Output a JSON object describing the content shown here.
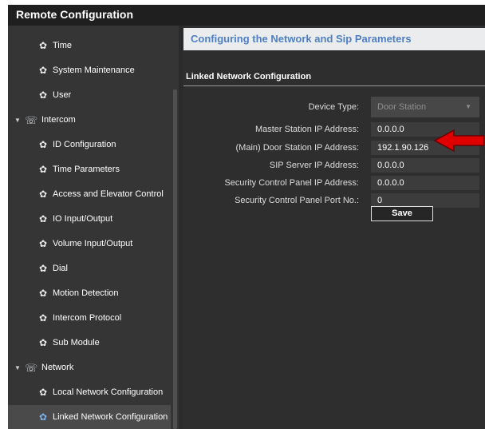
{
  "window": {
    "title": "Remote Configuration"
  },
  "sidebar": {
    "items": [
      {
        "label": "Time",
        "level": 2,
        "icon": "gear-icon"
      },
      {
        "label": "System Maintenance",
        "level": 2,
        "icon": "gear-icon"
      },
      {
        "label": "User",
        "level": 2,
        "icon": "gear-icon"
      },
      {
        "label": "Intercom",
        "level": 1,
        "icon": "intercom-icon",
        "expanded": true
      },
      {
        "label": "ID Configuration",
        "level": 2,
        "icon": "gear-icon"
      },
      {
        "label": "Time Parameters",
        "level": 2,
        "icon": "gear-icon"
      },
      {
        "label": "Access and Elevator Control",
        "level": 2,
        "icon": "gear-icon"
      },
      {
        "label": "IO Input/Output",
        "level": 2,
        "icon": "gear-icon"
      },
      {
        "label": "Volume Input/Output",
        "level": 2,
        "icon": "gear-icon"
      },
      {
        "label": "Dial",
        "level": 2,
        "icon": "gear-icon"
      },
      {
        "label": "Motion Detection",
        "level": 2,
        "icon": "gear-icon"
      },
      {
        "label": "Intercom Protocol",
        "level": 2,
        "icon": "gear-icon"
      },
      {
        "label": "Sub Module",
        "level": 2,
        "icon": "gear-icon"
      },
      {
        "label": "Network",
        "level": 1,
        "icon": "network-icon",
        "expanded": true
      },
      {
        "label": "Local Network Configuration",
        "level": 2,
        "icon": "gear-icon"
      },
      {
        "label": "Linked Network Configuration",
        "level": 2,
        "icon": "gear-icon",
        "selected": true
      }
    ]
  },
  "main": {
    "header": "Configuring the Network and Sip Parameters",
    "section_title": "Linked Network Configuration",
    "form": {
      "device_type": {
        "label": "Device Type:",
        "value": "Door Station"
      },
      "master_station_ip": {
        "label": "Master Station IP Address:",
        "value": "0.0.0.0"
      },
      "door_station_ip": {
        "label": "(Main) Door Station IP Address:",
        "value": "192.1.90.126"
      },
      "sip_server_ip": {
        "label": "SIP Server IP Address:",
        "value": "0.0.0.0"
      },
      "security_panel_ip": {
        "label": "Security Control Panel IP Address:",
        "value": "0.0.0.0"
      },
      "security_panel_port": {
        "label": "Security Control Panel Port No.:",
        "value": "0"
      }
    },
    "save_label": "Save"
  },
  "colors": {
    "header_text": "#4f7fc2",
    "annotation_arrow": "#e00000",
    "sidebar_bg": "#353535",
    "content_bg": "#2e2e2e"
  }
}
